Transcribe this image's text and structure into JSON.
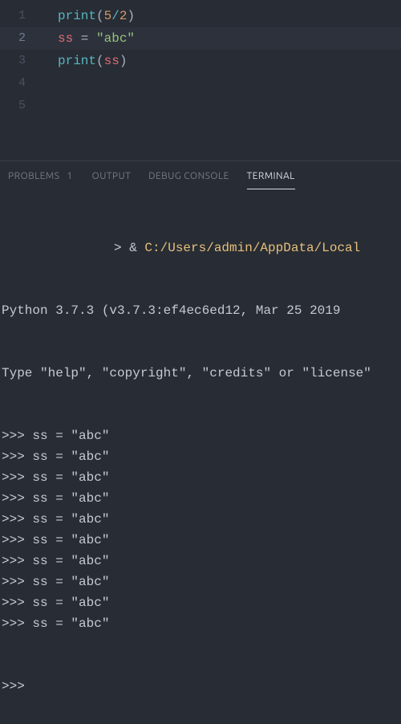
{
  "editor": {
    "active_line": 2,
    "lines": [
      {
        "num": "1",
        "tokens": [
          {
            "cls": "tok-fn",
            "t": "print"
          },
          {
            "cls": "tok-punc",
            "t": "("
          },
          {
            "cls": "tok-num",
            "t": "5"
          },
          {
            "cls": "tok-op",
            "t": "/"
          },
          {
            "cls": "tok-num",
            "t": "2"
          },
          {
            "cls": "tok-punc",
            "t": ")"
          }
        ]
      },
      {
        "num": "2",
        "tokens": [
          {
            "cls": "tok-var",
            "t": "ss"
          },
          {
            "cls": "tok-assign",
            "t": " = "
          },
          {
            "cls": "tok-str",
            "t": "\"abc\""
          }
        ]
      },
      {
        "num": "3",
        "tokens": [
          {
            "cls": "tok-fn",
            "t": "print"
          },
          {
            "cls": "tok-punc",
            "t": "("
          },
          {
            "cls": "tok-var",
            "t": "ss"
          },
          {
            "cls": "tok-punc",
            "t": ")"
          }
        ]
      },
      {
        "num": "4",
        "tokens": []
      },
      {
        "num": "5",
        "tokens": []
      }
    ]
  },
  "panel": {
    "tabs": {
      "problems": "PROBLEMS",
      "problems_count": "1",
      "output": "OUTPUT",
      "debug": "DEBUG CONSOLE",
      "terminal": "TERMINAL"
    }
  },
  "terminal": {
    "cmd_prefix": "> & ",
    "cmd_path": "C:/Users/admin/AppData/Local",
    "banner1": "Python 3.7.3 (v3.7.3:ef4ec6ed12, Mar 25 2019",
    "banner2": "Type \"help\", \"copyright\", \"credits\" or \"license\"",
    "repl_line": ">>> ss = \"abc\"",
    "repl_count": 10,
    "prompt": ">>> "
  }
}
